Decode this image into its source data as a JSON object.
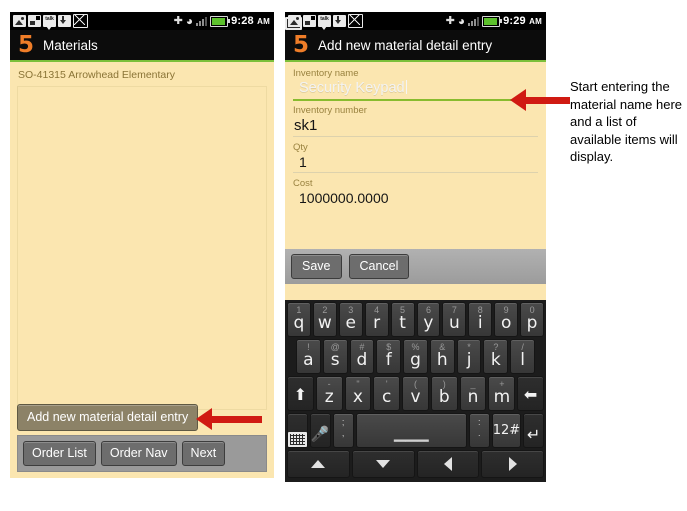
{
  "phone_left": {
    "status_bar": {
      "time": "9:28",
      "meridiem": "AM",
      "icons": [
        "picture-icon",
        "screenshot-icon",
        "talk-icon",
        "download-icon",
        "mail-icon"
      ],
      "right_icons": [
        "gps-icon",
        "wifi-icon",
        "signal-icon",
        "battery-icon"
      ]
    },
    "title": {
      "logo": "5",
      "text": "Materials"
    },
    "list_header": "SO-41315 Arrowhead Elementary",
    "add_button": "Add new material detail entry",
    "nav_buttons": [
      "Order List",
      "Order Nav",
      "Next"
    ]
  },
  "phone_right": {
    "status_bar": {
      "time": "9:29",
      "meridiem": "AM",
      "icons": [
        "keyboard-icon",
        "picture-icon",
        "screenshot-icon",
        "talk-icon",
        "download-icon",
        "mail-icon"
      ],
      "right_icons": [
        "gps-icon",
        "wifi-icon",
        "signal-icon",
        "battery-icon"
      ]
    },
    "title": {
      "logo": "5",
      "text": "Add new material detail entry"
    },
    "fields": [
      {
        "label": "Inventory name",
        "value": "Security Keypad",
        "focused": true
      },
      {
        "label": "Inventory number",
        "value": "sk1",
        "focused": false
      },
      {
        "label": "Qty",
        "value": "1",
        "focused": false
      },
      {
        "label": "Cost",
        "value": "1000000.0000",
        "focused": false
      }
    ],
    "actions": [
      "Save",
      "Cancel"
    ],
    "keyboard": {
      "row1": [
        {
          "sup": "1",
          "main": "q"
        },
        {
          "sup": "2",
          "main": "w"
        },
        {
          "sup": "3",
          "main": "e"
        },
        {
          "sup": "4",
          "main": "r"
        },
        {
          "sup": "5",
          "main": "t"
        },
        {
          "sup": "6",
          "main": "y"
        },
        {
          "sup": "7",
          "main": "u"
        },
        {
          "sup": "8",
          "main": "i"
        },
        {
          "sup": "9",
          "main": "o"
        },
        {
          "sup": "0",
          "main": "p"
        }
      ],
      "row2": [
        {
          "sup": "!",
          "main": "a"
        },
        {
          "sup": "@",
          "main": "s"
        },
        {
          "sup": "#",
          "main": "d"
        },
        {
          "sup": "$",
          "main": "f"
        },
        {
          "sup": "%",
          "main": "g"
        },
        {
          "sup": "&",
          "main": "h"
        },
        {
          "sup": "*",
          "main": "j"
        },
        {
          "sup": "?",
          "main": "k"
        },
        {
          "sup": "/",
          "main": "l"
        }
      ],
      "row3": [
        {
          "sup": "-",
          "main": "z"
        },
        {
          "sup": "\"",
          "main": "x"
        },
        {
          "sup": "'",
          "main": "c"
        },
        {
          "sup": "(",
          "main": "v"
        },
        {
          "sup": ")",
          "main": "b"
        },
        {
          "sup": "_",
          "main": "n"
        },
        {
          "sup": "+",
          "main": "m"
        }
      ],
      "shift_key": "shift-icon",
      "backspace_key": "backspace-icon",
      "keyboard_key": "keyboard-icon",
      "mic_key": "microphone-icon",
      "comma_key": {
        "sup": ";",
        "main": ","
      },
      "period_key": {
        "sup": ":",
        "main": "."
      },
      "space_key": "space-bar",
      "symbols_key": "12#",
      "enter_key": "enter-icon",
      "nav_keys": [
        "up-arrow",
        "down-arrow",
        "left-arrow",
        "right-arrow"
      ]
    }
  },
  "annotation": {
    "text": "Start entering the material name here and a list of available items will display.",
    "arrow_color": "#d01a12"
  }
}
